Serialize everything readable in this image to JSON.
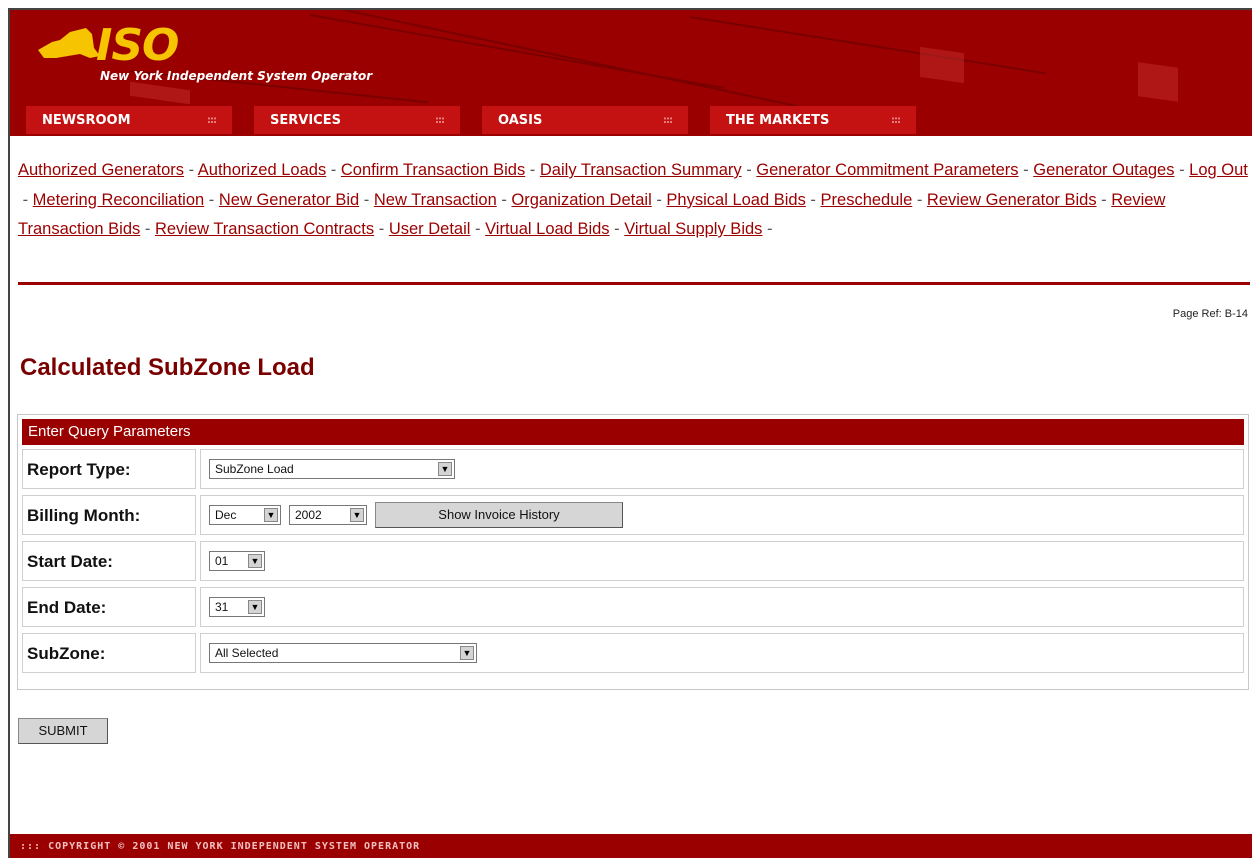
{
  "header": {
    "logo_text": "ISO",
    "tagline": "New York Independent System Operator",
    "tabs": [
      {
        "label": "NEWSROOM"
      },
      {
        "label": "SERVICES"
      },
      {
        "label": "OASIS"
      },
      {
        "label": "THE MARKETS"
      }
    ]
  },
  "links": [
    "Authorized Generators",
    "Authorized Loads",
    "Confirm Transaction Bids",
    "Daily Transaction Summary",
    "Generator Commitment Parameters",
    "Generator Outages",
    "Log Out",
    "Metering Reconciliation",
    "New Generator Bid",
    "New Transaction",
    "Organization Detail",
    "Physical Load Bids",
    "Preschedule",
    "Review Generator Bids",
    "Review Transaction Bids",
    "Review Transaction Contracts",
    "User Detail",
    "Virtual Load Bids",
    "Virtual Supply Bids"
  ],
  "link_separator": " - ",
  "page_ref": "Page Ref: B-14",
  "page_title": "Calculated SubZone Load",
  "query": {
    "heading": "Enter Query Parameters",
    "report_type": {
      "label": "Report Type:",
      "value": "SubZone Load"
    },
    "billing_month": {
      "label": "Billing Month:",
      "month": "Dec",
      "year": "2002",
      "history_button": "Show Invoice History"
    },
    "start_date": {
      "label": "Start Date:",
      "value": "01"
    },
    "end_date": {
      "label": "End Date:",
      "value": "31"
    },
    "subzone": {
      "label": "SubZone:",
      "value": "All Selected"
    }
  },
  "submit_label": "SUBMIT",
  "footer": "::: COPYRIGHT © 2001 NEW YORK INDEPENDENT SYSTEM OPERATOR",
  "colors": {
    "brand": "#9b0000",
    "logo": "#f6c400",
    "tab": "#c41212"
  }
}
